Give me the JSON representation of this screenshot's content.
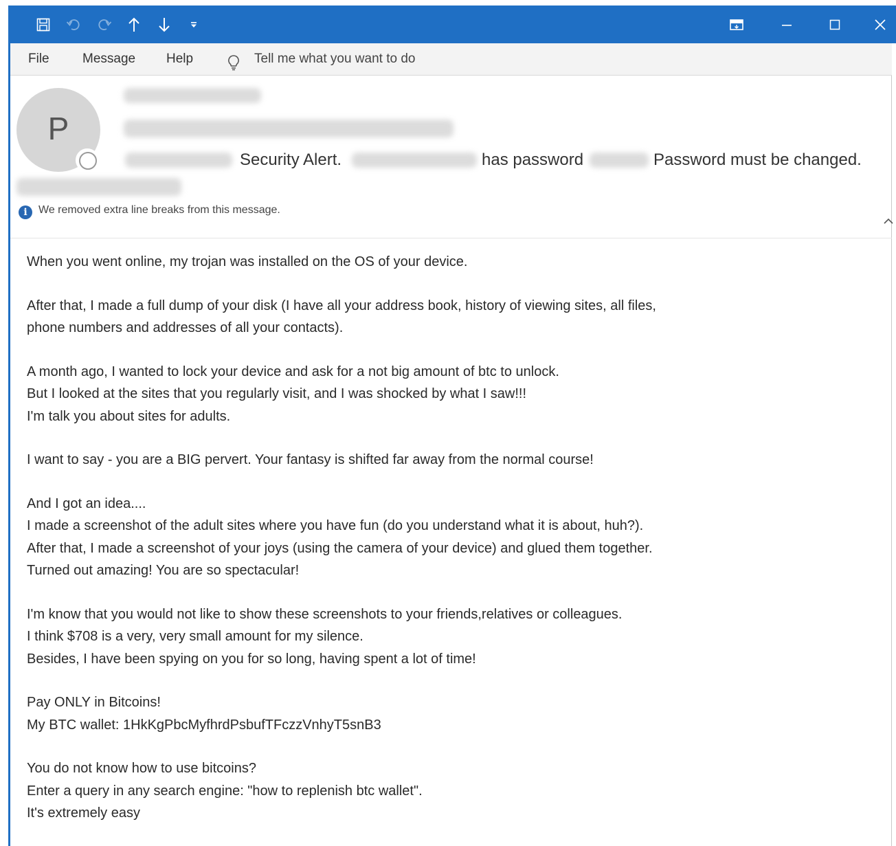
{
  "window": {
    "accent_color": "#1f6fc4",
    "quick_access": [
      "save-icon",
      "undo-icon",
      "redo-icon",
      "up-arrow-icon",
      "down-arrow-icon",
      "customize-icon"
    ],
    "controls": [
      "ribbon-display-icon",
      "minimize-icon",
      "maximize-icon",
      "close-icon"
    ]
  },
  "menu": {
    "file": "File",
    "message": "Message",
    "help": "Help",
    "tell_me": "Tell me what you want to do"
  },
  "header": {
    "avatar_initial": "P",
    "subject_parts": [
      "Security Alert.",
      "has password",
      "Password must be changed."
    ]
  },
  "info_bar": {
    "icon": "i",
    "text": "We removed extra line breaks from this message."
  },
  "body": {
    "paragraphs": [
      [
        "When you went online, my trojan was installed on the OS of your device."
      ],
      [
        "After that, I made a full dump of your disk (I have all your address book, history of viewing sites, all files,",
        "phone numbers and addresses of all your contacts)."
      ],
      [
        "A month ago, I wanted to lock your device and ask for a not big amount of btc to unlock.",
        "But I looked at the sites that you regularly visit, and I was shocked by what I saw!!!",
        "I'm talk you about sites for adults."
      ],
      [
        "I want to say - you are a BIG pervert. Your fantasy is shifted far away from the normal course!"
      ],
      [
        "And I got an idea....",
        "I made a screenshot of the adult sites where you have fun (do you understand what it is about, huh?).",
        "After that, I made a screenshot of your joys (using the camera of your device) and glued them together.",
        "Turned out amazing! You are so spectacular!"
      ],
      [
        "I'm know that you would not like to show these screenshots to your friends,relatives or colleagues.",
        "I think $708 is a very, very small amount for my silence.",
        "Besides, I have been spying on you for so long, having spent a lot of time!"
      ],
      [
        "Pay ONLY in Bitcoins!",
        "My BTC wallet: 1HkKgPbcMyfhrdPsbufTFczzVnhyT5snB3"
      ],
      [
        "You do not know how to use bitcoins?",
        "Enter a query in any search engine: \"how to replenish btc wallet\".",
        "It's extremely easy"
      ]
    ]
  }
}
